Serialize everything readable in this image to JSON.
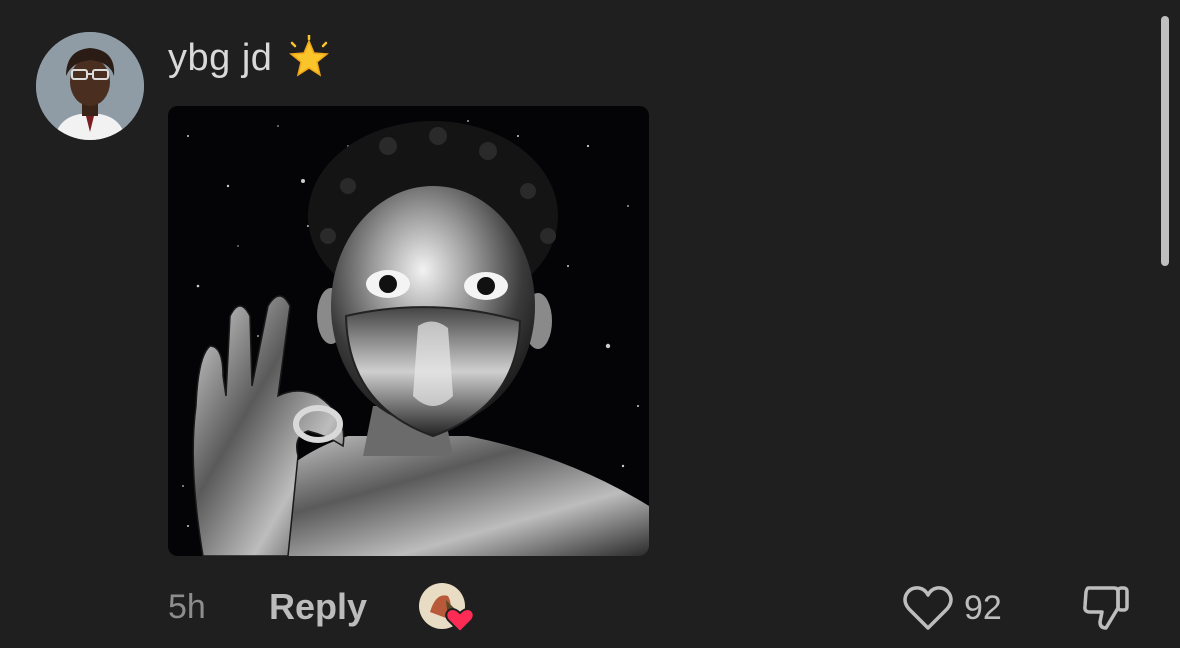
{
  "comment": {
    "username": "ybg jd",
    "badge_icon": "star-badge-icon",
    "media_alt": "chrome-figure-ok-gesture-image",
    "time": "5h",
    "reply_label": "Reply",
    "creator_liked": true,
    "like_count": "92",
    "liked": false
  },
  "colors": {
    "background": "#1f1f1f",
    "username": "#d9d9d9",
    "muted": "#8d8d8d",
    "heart_accent": "#fe2c55"
  }
}
